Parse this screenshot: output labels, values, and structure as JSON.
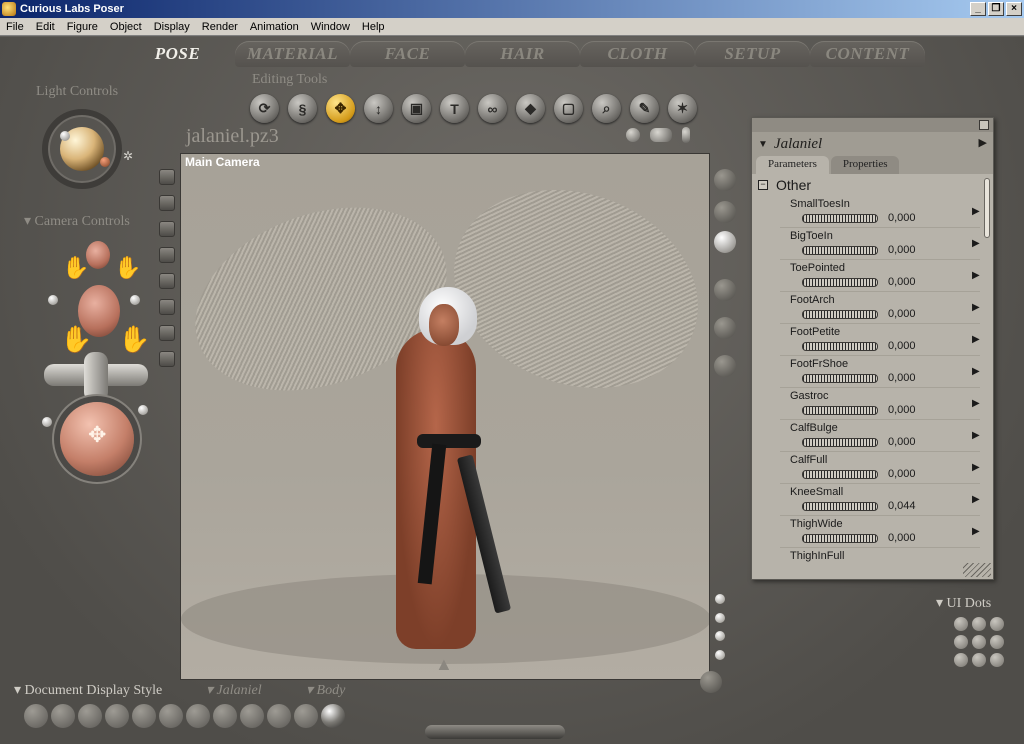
{
  "window": {
    "title": "Curious Labs Poser"
  },
  "menu": [
    "File",
    "Edit",
    "Figure",
    "Object",
    "Display",
    "Render",
    "Animation",
    "Window",
    "Help"
  ],
  "rooms": [
    "POSE",
    "MATERIAL",
    "FACE",
    "HAIR",
    "CLOTH",
    "SETUP",
    "CONTENT"
  ],
  "active_room": "POSE",
  "labels": {
    "light_controls": "Light Controls",
    "editing_tools": "Editing Tools",
    "camera_controls": "Camera Controls",
    "document_display_style": "Document Display Style",
    "figure_display_style": "Jalaniel",
    "element_display_style": "Body",
    "ui_dots": "UI Dots"
  },
  "document": {
    "filename": "jalaniel.pz3",
    "camera": "Main Camera"
  },
  "editing_tools": [
    "rotate-icon",
    "twist-icon",
    "translate-icon",
    "translate-in-out-icon",
    "scale-icon",
    "taper-icon",
    "chain-break-icon",
    "color-icon",
    "grouping-icon",
    "view-magnifier-icon",
    "morphing-tool-icon",
    "direct-manipulation-icon"
  ],
  "active_tool": "translate-icon",
  "panel": {
    "figure_name": "Jalaniel",
    "tabs": [
      "Parameters",
      "Properties"
    ],
    "active_tab": "Parameters",
    "group": "Other",
    "parameters": [
      {
        "name": "SmallToesIn",
        "value": "0,000"
      },
      {
        "name": "BigToeIn",
        "value": "0,000"
      },
      {
        "name": "ToePointed",
        "value": "0,000"
      },
      {
        "name": "FootArch",
        "value": "0,000"
      },
      {
        "name": "FootPetite",
        "value": "0,000"
      },
      {
        "name": "FootFrShoe",
        "value": "0,000"
      },
      {
        "name": "Gastroc",
        "value": "0,000"
      },
      {
        "name": "CalfBulge",
        "value": "0,000"
      },
      {
        "name": "CalfFull",
        "value": "0,000"
      },
      {
        "name": "KneeSmall",
        "value": "0,044"
      },
      {
        "name": "ThighWide",
        "value": "0,000"
      },
      {
        "name": "ThighInFull",
        "value": ""
      }
    ]
  }
}
